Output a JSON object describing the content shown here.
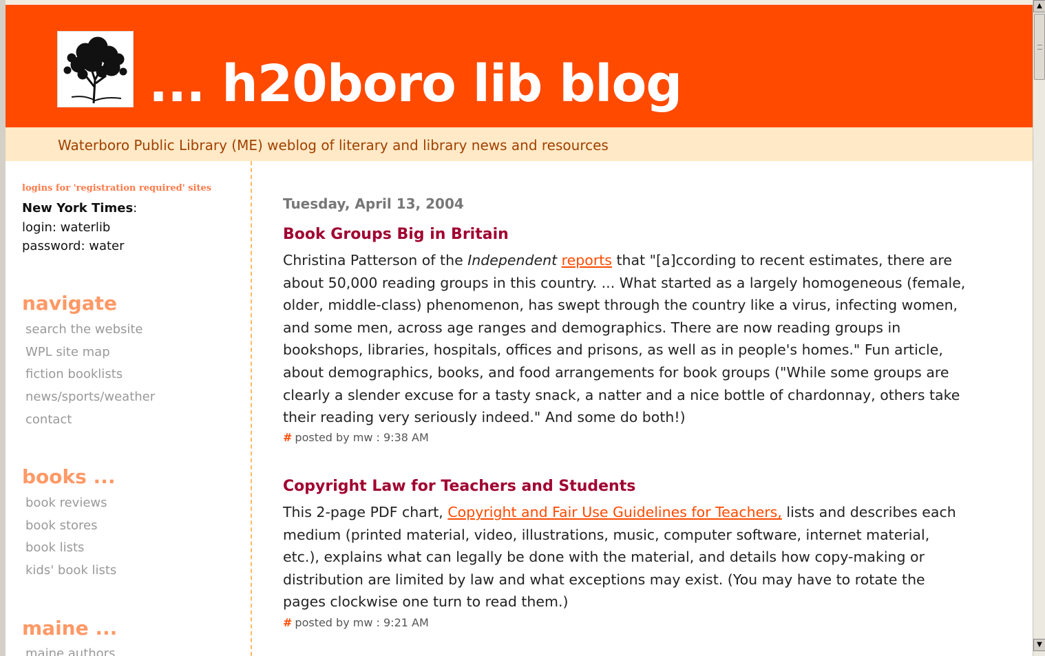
{
  "header": {
    "title": "... h20boro lib blog",
    "description": "Waterboro Public Library (ME) weblog of literary and library news and resources"
  },
  "sidebar": {
    "logins_heading": "logins for 'registration required' sites",
    "nyt_label": "New York Times",
    "nyt_colon": ":",
    "login": "login: waterlib",
    "password": "password: water",
    "navigate": {
      "heading": "navigate",
      "items": [
        "search the website",
        "WPL site map",
        "fiction booklists",
        "news/sports/weather",
        "contact"
      ]
    },
    "books": {
      "heading": "books ...",
      "items": [
        "book reviews",
        "book stores",
        "book lists",
        "kids' book lists"
      ]
    },
    "maine": {
      "heading": "maine ...",
      "items": [
        "maine authors"
      ]
    }
  },
  "main": {
    "date": "Tuesday, April 13, 2004",
    "posts": [
      {
        "title": "Book Groups Big in Britain",
        "body_a": "Christina Patterson of the ",
        "body_em": "Independent",
        "body_b": " ",
        "link": "reports",
        "body_c": " that \"[a]ccording to recent estimates, there are about 50,000 reading groups in this country. ... What started as a largely homogeneous (female, older, middle-class) phenomenon, has swept through the country like a virus, infecting women, and some men, across age ranges and demographics. There are now reading groups in bookshops, libraries, hospitals, offices and prisons, as well as in people's homes.\" Fun article, about demographics, books, and food arrangements for book groups (\"While some groups are clearly a slender excuse for a tasty snack, a natter and a nice bottle of chardonnay, others take their reading very seriously indeed.\" And some do both!)",
        "hash": "#",
        "footer": "posted by mw : 9:38 AM"
      },
      {
        "title": "Copyright Law for Teachers and Students",
        "body_a": "This 2-page PDF chart, ",
        "link": "Copyright and Fair Use Guidelines for Teachers,",
        "body_c": " lists and describes each medium (printed material, video, illustrations, music, computer software, internet material, etc.), explains what can legally be done with the material, and details how copy-making or distribution are limited by law and what exceptions may exist. (You may have to rotate the pages clockwise one turn to read them.)",
        "hash": "#",
        "footer": "posted by mw : 9:21 AM"
      }
    ]
  },
  "scrollbar": {
    "up_icon": "▲",
    "down_icon": "▼"
  },
  "colors": {
    "header_bg": "#ff4a00",
    "desc_bg": "#ffe9c6",
    "post_title": "#a00030",
    "link": "#ff4a00"
  }
}
